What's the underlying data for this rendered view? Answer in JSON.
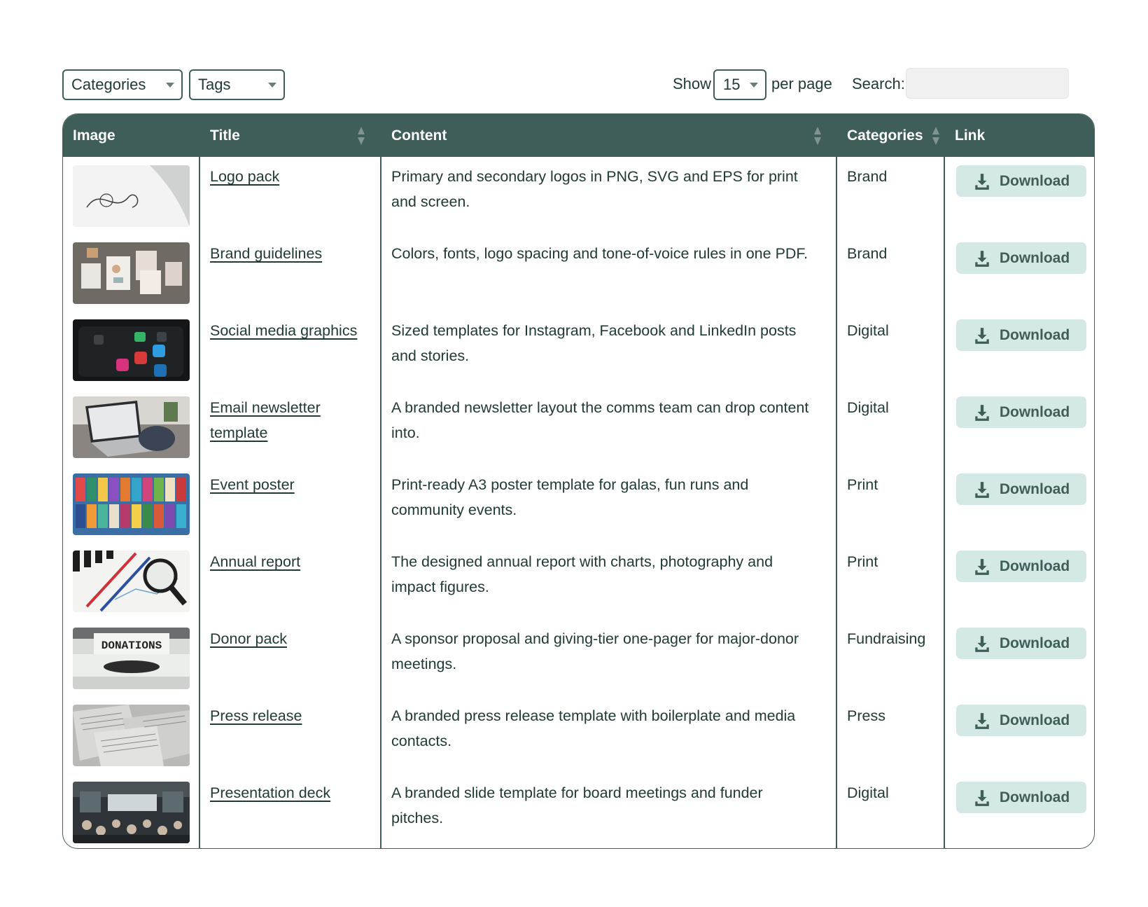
{
  "filters": {
    "categories_label": "Categories",
    "tags_label": "Tags"
  },
  "pagination": {
    "show_label": "Show",
    "per_page_value": "15",
    "per_page_label": "per page"
  },
  "search": {
    "label": "Search:",
    "value": "",
    "placeholder": ""
  },
  "table": {
    "headers": {
      "image": "Image",
      "title": "Title",
      "content": "Content",
      "categories": "Categories",
      "link": "Link"
    },
    "rows": [
      {
        "title": "Logo pack",
        "content": "Primary and secondary logos in PNG, SVG and EPS for print and screen.",
        "category": "Brand",
        "link": "Download",
        "image": "logo-pack-image"
      },
      {
        "title": "Brand guidelines",
        "content": "Colors, fonts, logo spacing and tone-of-voice rules in one PDF.",
        "category": "Brand",
        "link": "Download",
        "image": "brand-guidelines-image"
      },
      {
        "title": "Social media graphics",
        "content": "Sized templates for Instagram, Facebook and LinkedIn posts and stories.",
        "category": "Digital",
        "link": "Download",
        "image": "social-media-image"
      },
      {
        "title": "Email newsletter template",
        "content": "A branded newsletter layout the comms team can drop content into.",
        "category": "Digital",
        "link": "Download",
        "image": "laptop-image"
      },
      {
        "title": "Event poster",
        "content": "Print-ready A3 poster template for galas, fun runs and community events.",
        "category": "Print",
        "link": "Download",
        "image": "poster-wall-image"
      },
      {
        "title": "Annual report",
        "content": "The designed annual report with charts, photography and impact figures.",
        "category": "Print",
        "link": "Download",
        "image": "report-magnifier-image"
      },
      {
        "title": "Donor pack",
        "content": "A sponsor proposal and giving-tier one-pager for major-donor meetings.",
        "category": "Fundraising",
        "link": "Download",
        "image": "donations-typewriter-image",
        "image_text": "DONATIONS"
      },
      {
        "title": "Press release",
        "content": "A branded press release template with boilerplate and media contacts.",
        "category": "Press",
        "link": "Download",
        "image": "newspapers-image"
      },
      {
        "title": "Presentation deck",
        "content": "A branded slide template for board meetings and funder pitches.",
        "category": "Digital",
        "link": "Download",
        "image": "conference-room-image"
      }
    ]
  },
  "colors": {
    "header_bg": "#3f5e59",
    "button_bg": "#d4e8e6",
    "text": "#213a35"
  }
}
